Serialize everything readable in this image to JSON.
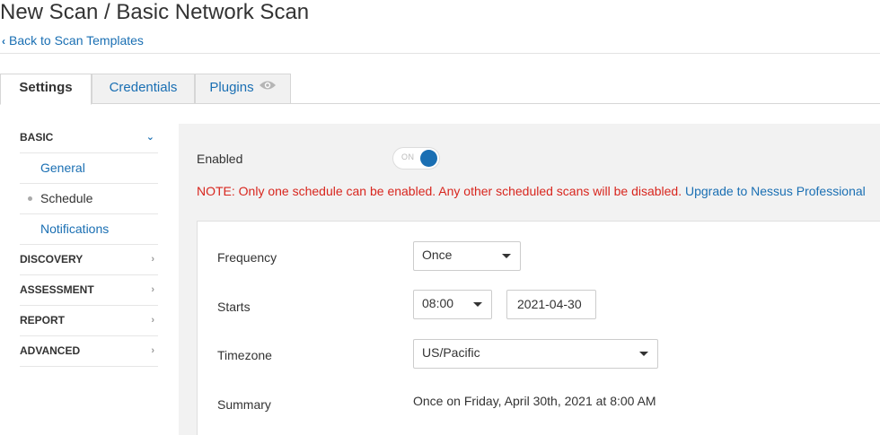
{
  "header": {
    "title": "New Scan / Basic Network Scan",
    "back_link": "Back to Scan Templates"
  },
  "tabs": [
    {
      "label": "Settings",
      "active": true
    },
    {
      "label": "Credentials",
      "active": false
    },
    {
      "label": "Plugins",
      "active": false,
      "icon": "eye-icon"
    }
  ],
  "sidebar": {
    "sections": [
      {
        "label": "BASIC",
        "expanded": true,
        "items": [
          {
            "label": "General"
          },
          {
            "label": "Schedule",
            "selected": true
          },
          {
            "label": "Notifications"
          }
        ]
      },
      {
        "label": "DISCOVERY",
        "expanded": false
      },
      {
        "label": "ASSESSMENT",
        "expanded": false
      },
      {
        "label": "REPORT",
        "expanded": false
      },
      {
        "label": "ADVANCED",
        "expanded": false
      }
    ]
  },
  "schedule": {
    "enabled_label": "Enabled",
    "toggle_text": "ON",
    "toggle_state": true,
    "note": "NOTE: Only one schedule can be enabled. Any other scheduled scans will be disabled.",
    "upgrade_link": "Upgrade to Nessus Professional",
    "frequency_label": "Frequency",
    "frequency_value": "Once",
    "starts_label": "Starts",
    "start_time": "08:00",
    "start_date": "2021-04-30",
    "timezone_label": "Timezone",
    "timezone_value": "US/Pacific",
    "summary_label": "Summary",
    "summary_value": "Once on Friday, April 30th, 2021 at 8:00 AM"
  },
  "colors": {
    "link": "#1a6fb3",
    "warning": "#d8261e",
    "panel_bg": "#f2f2f2"
  }
}
